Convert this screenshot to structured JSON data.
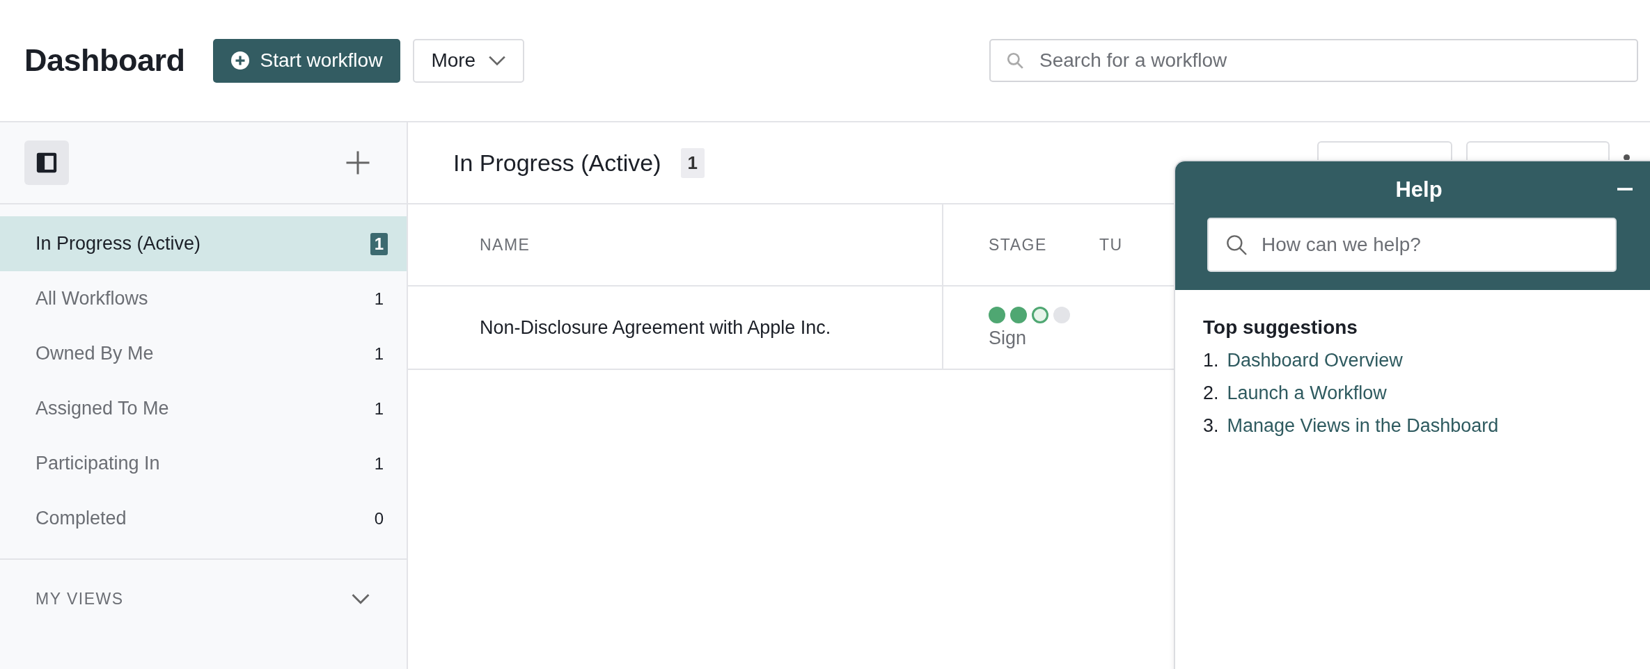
{
  "header": {
    "title": "Dashboard",
    "start_button": "Start workflow",
    "more_button": "More",
    "search": {
      "placeholder": "Search for a workflow"
    }
  },
  "sidebar": {
    "items": [
      {
        "label": "In Progress (Active)",
        "count": "1",
        "selected": true
      },
      {
        "label": "All Workflows",
        "count": "1",
        "selected": false
      },
      {
        "label": "Owned By Me",
        "count": "1",
        "selected": false
      },
      {
        "label": "Assigned To Me",
        "count": "1",
        "selected": false
      },
      {
        "label": "Participating In",
        "count": "1",
        "selected": false
      },
      {
        "label": "Completed",
        "count": "0",
        "selected": false
      }
    ],
    "section": {
      "label": "MY VIEWS",
      "expanded": false
    }
  },
  "main": {
    "title": "In Progress (Active)",
    "count": "1",
    "table": {
      "columns": [
        "NAME",
        "STAGE",
        "TU"
      ],
      "rows": [
        {
          "name": "Non-Disclosure Agreement with Apple Inc.",
          "stage": {
            "steps": [
              {
                "kind": "done"
              },
              {
                "kind": "done"
              },
              {
                "kind": "current"
              },
              {
                "kind": "pending"
              }
            ],
            "label": "Sign"
          }
        }
      ]
    }
  },
  "help": {
    "title": "Help",
    "search": {
      "placeholder": "How can we help?"
    },
    "heading": "Top suggestions",
    "suggestions": [
      {
        "number": "1.",
        "label": "Dashboard Overview"
      },
      {
        "number": "2.",
        "label": "Launch a Workflow"
      },
      {
        "number": "3.",
        "label": "Manage Views in the Dashboard"
      }
    ]
  }
}
